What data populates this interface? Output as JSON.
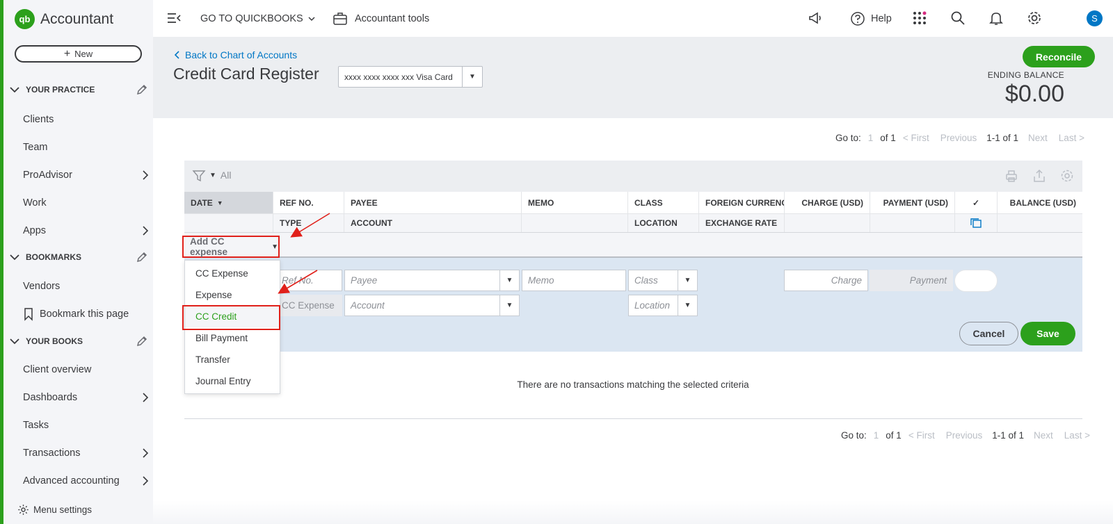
{
  "sidebar": {
    "brand": "Accountant",
    "brand_logo": "qb",
    "new_button": "New",
    "sections": [
      {
        "label": "YOUR PRACTICE"
      },
      {
        "label": "BOOKMARKS"
      },
      {
        "label": "YOUR BOOKS"
      }
    ],
    "items": [
      {
        "label": "Clients"
      },
      {
        "label": "Team"
      },
      {
        "label": "ProAdvisor"
      },
      {
        "label": "Work"
      },
      {
        "label": "Apps"
      },
      {
        "label": "Vendors"
      },
      {
        "label": "Bookmark this page"
      },
      {
        "label": "Client overview"
      },
      {
        "label": "Dashboards"
      },
      {
        "label": "Tasks"
      },
      {
        "label": "Transactions"
      },
      {
        "label": "Advanced accounting"
      }
    ],
    "menu_settings": "Menu settings"
  },
  "topbar": {
    "goto_quickbooks": "GO TO QUICKBOOKS",
    "accountant_tools": "Accountant tools",
    "help": "Help",
    "avatar_initial": "S"
  },
  "header": {
    "back_link": "Back to Chart of Accounts",
    "title": "Credit Card Register",
    "account_select": "xxxx xxxx xxxx xxx Visa Card",
    "reconcile": "Reconcile",
    "ending_balance_label": "ENDING BALANCE",
    "ending_balance_value": "$0.00"
  },
  "pagination": {
    "goto_label": "Go to:",
    "page": "1",
    "of": "of 1",
    "first": "< First",
    "previous": "Previous",
    "range": "1-1 of 1",
    "next": "Next",
    "last": "Last >"
  },
  "register": {
    "filter_label": "All",
    "columns_row1": [
      "DATE",
      "REF NO.",
      "PAYEE",
      "MEMO",
      "CLASS",
      "FOREIGN CURRENCY",
      "CHARGE (USD)",
      "PAYMENT (USD)",
      "✓",
      "BALANCE (USD)"
    ],
    "columns_row2": [
      "",
      "TYPE",
      "ACCOUNT",
      "",
      "LOCATION",
      "EXCHANGE RATE",
      "",
      "",
      "",
      ""
    ],
    "add_button": "Add CC expense",
    "placeholders": {
      "ref_no": "Ref No.",
      "payee": "Payee",
      "memo": "Memo",
      "class": "Class",
      "charge": "Charge",
      "payment": "Payment",
      "type": "CC Expense",
      "account": "Account",
      "location": "Location"
    },
    "cancel": "Cancel",
    "save": "Save",
    "empty_message": "There are no transactions matching the selected criteria"
  },
  "dropdown": {
    "items": [
      {
        "label": "CC Expense"
      },
      {
        "label": "Expense"
      },
      {
        "label": "CC Credit"
      },
      {
        "label": "Bill Payment"
      },
      {
        "label": "Transfer"
      },
      {
        "label": "Journal Entry"
      }
    ],
    "selected": "CC Credit"
  },
  "colors": {
    "brand_green": "#2ca01c",
    "link_blue": "#0077c5",
    "highlight_red": "#e0201a"
  }
}
